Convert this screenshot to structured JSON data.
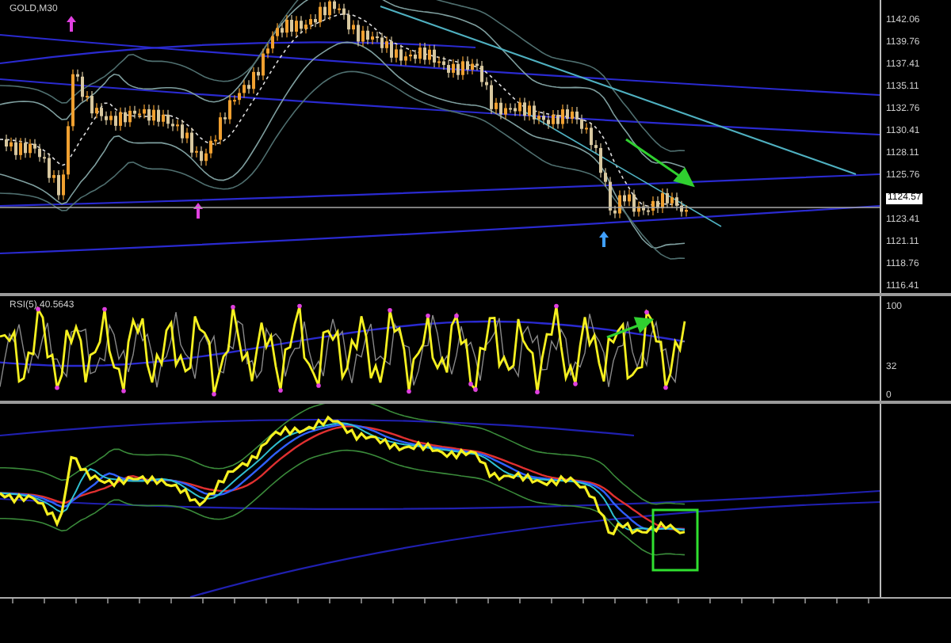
{
  "price_panel": {
    "title": "GOLD,M30",
    "price_labels": [
      {
        "text": "1142.06",
        "kind": "tick"
      },
      {
        "text": "1139.76",
        "kind": "tick"
      },
      {
        "text": "1137.41",
        "kind": "tick"
      },
      {
        "text": "1135.11",
        "kind": "tick"
      },
      {
        "text": "1132.76",
        "kind": "tick"
      },
      {
        "text": "1130.41",
        "kind": "tick"
      },
      {
        "text": "1128.11",
        "kind": "tick"
      },
      {
        "text": "1125.76",
        "kind": "tick"
      },
      {
        "text": "1124.57",
        "kind": "current"
      },
      {
        "text": "1123.41",
        "kind": "tick"
      },
      {
        "text": "1121.11",
        "kind": "tick"
      },
      {
        "text": "1118.76",
        "kind": "tick"
      },
      {
        "text": "1116.41",
        "kind": "tick"
      }
    ]
  },
  "rsi_panel": {
    "title": "RSI(5) 40.5643",
    "scale_labels": [
      "100",
      "32",
      "0"
    ]
  }
}
